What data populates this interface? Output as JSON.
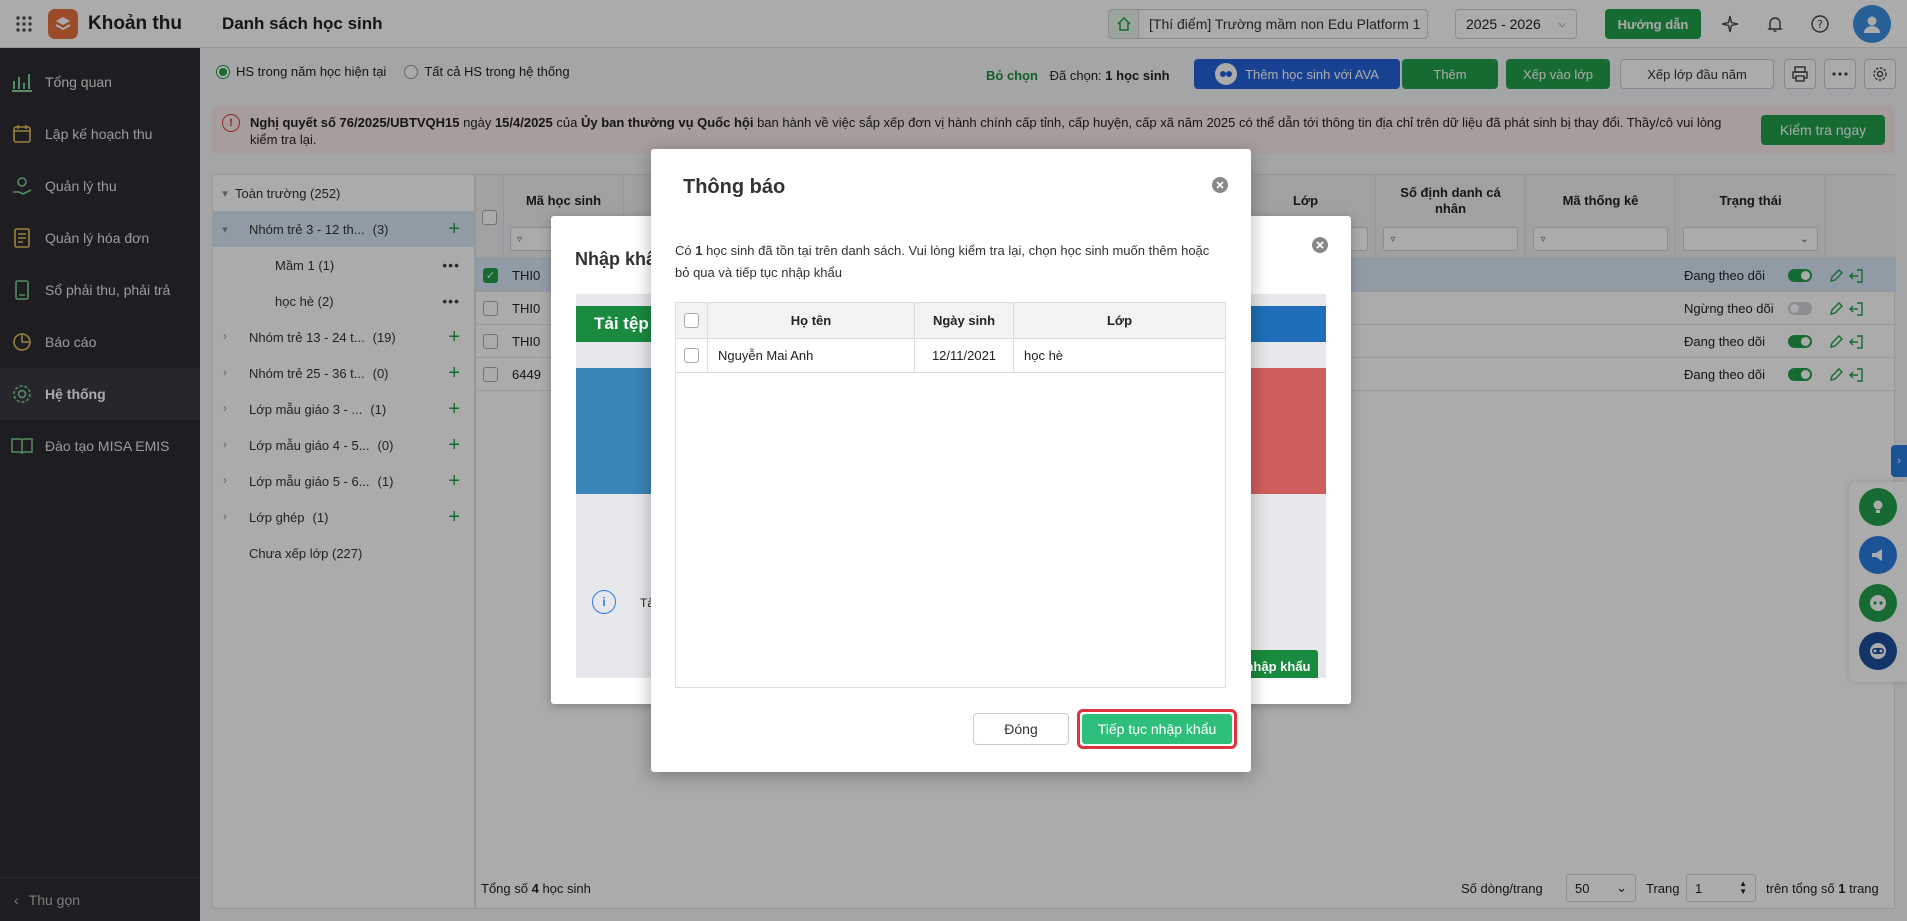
{
  "header": {
    "app_name": "Khoản thu",
    "page_title": "Danh sách học sinh",
    "school": "[Thí điểm] Trường mầm non Edu Platform 1",
    "school_year": "2025 - 2026",
    "guide_label": "Hướng dẫn"
  },
  "sidebar": {
    "items": [
      {
        "label": "Tổng quan",
        "icon": "chart-icon"
      },
      {
        "label": "Lập kế hoạch thu",
        "icon": "calendar-money-icon"
      },
      {
        "label": "Quản lý thu",
        "icon": "money-hand-icon"
      },
      {
        "label": "Quản lý hóa đơn",
        "icon": "invoice-icon"
      },
      {
        "label": "Sổ phải thu, phải trả",
        "icon": "ledger-icon"
      },
      {
        "label": "Báo cáo",
        "icon": "pie-chart-icon"
      },
      {
        "label": "Hệ thống",
        "icon": "gear-icon"
      },
      {
        "label": "Đào tạo MISA EMIS",
        "icon": "book-icon"
      }
    ],
    "collapse_label": "Thu gọn"
  },
  "filters": {
    "radio_current": "HS trong năm học hiện tại",
    "radio_all": "Tất cả HS trong hệ thống",
    "deselect_label": "Bỏ chọn",
    "selected_prefix": "Đã chọn:",
    "selected_value": "1 học sinh"
  },
  "toolbar": {
    "add_ava": "Thêm học sinh với AVA",
    "add": "Thêm",
    "assign_class": "Xếp vào lớp",
    "assign_start": "Xếp lớp đầu năm"
  },
  "notice": {
    "bold_1": "Nghị quyết số 76/2025/UBTVQH15",
    "text_1": " ngày ",
    "bold_2": "15/4/2025",
    "text_2": " của ",
    "bold_3": "Ủy ban thường vụ Quốc hội",
    "text_3": " ban hành về việc sắp xếp đơn vị hành chính cấp tỉnh, cấp huyện, cấp xã năm 2025 có thể dẫn tới thông tin địa chỉ trên dữ liệu đã phát sinh bị thay đổi. Thầy/cô vui lòng kiểm tra lại.",
    "button": "Kiểm tra ngay"
  },
  "tree": [
    {
      "label": "Toàn trường (252)",
      "level": 0,
      "arrow": "▾",
      "action": ""
    },
    {
      "label": "Nhóm trẻ 3 - 12 th...",
      "count": "(3)",
      "level": 1,
      "arrow": "▾",
      "action": "+",
      "selected": true
    },
    {
      "label": "Mầm 1 (1)",
      "level": 2,
      "arrow": "",
      "action": "•••"
    },
    {
      "label": "học hè  (2)",
      "level": 2,
      "arrow": "",
      "action": "•••"
    },
    {
      "label": "Nhóm trẻ 13 - 24 t...",
      "count": "(19)",
      "level": 1,
      "arrow": "›",
      "action": "+"
    },
    {
      "label": "Nhóm trẻ 25 - 36 t...",
      "count": "(0)",
      "level": 1,
      "arrow": "›",
      "action": "+"
    },
    {
      "label": "Lớp mẫu giáo 3 - ...",
      "count": "(1)",
      "level": 1,
      "arrow": "›",
      "action": "+"
    },
    {
      "label": "Lớp mẫu giáo 4 - 5...",
      "count": "(0)",
      "level": 1,
      "arrow": "›",
      "action": "+"
    },
    {
      "label": "Lớp mẫu giáo 5 - 6...",
      "count": "(1)",
      "level": 1,
      "arrow": "›",
      "action": "+"
    },
    {
      "label": "Lớp ghép",
      "count": "(1)",
      "level": 1,
      "arrow": "›",
      "action": "+"
    },
    {
      "label": "Chưa xếp lớp  (227)",
      "level": 1,
      "arrow": "",
      "action": ""
    }
  ],
  "table": {
    "columns": [
      "Mã học sinh",
      "Lớp",
      "Số định danh cá nhân",
      "Mã thống kê",
      "Trạng thái"
    ],
    "rows": [
      {
        "code": "THI0",
        "status": "Đang theo dõi",
        "on": true,
        "checked": true
      },
      {
        "code": "THI0",
        "status": "Ngừng theo dõi",
        "on": false,
        "checked": false
      },
      {
        "code": "THI0",
        "status": "Đang theo dõi",
        "on": true,
        "checked": false
      },
      {
        "code": "6449",
        "status": "Đang theo dõi",
        "on": true,
        "checked": false
      }
    ],
    "footer_total_prefix": "Tổng số ",
    "footer_total_value": "4",
    "footer_total_suffix": " học sinh",
    "rows_per_page_label": "Số dòng/trang",
    "rows_per_page": "50",
    "page_label": "Trang",
    "page": "1",
    "total_pages_prefix": "trên tổng số ",
    "total_pages": "1",
    "total_pages_suffix": " trang"
  },
  "import_dialog": {
    "title": "Nhập khẩu",
    "banner": "Tải tệp",
    "info_text": "Tả",
    "import_btn": "nhập khẩu"
  },
  "notify_dialog": {
    "title": "Thông báo",
    "message_1": "Có ",
    "message_count": "1",
    "message_2": " học sinh đã tồn tại trên danh sách. Vui lòng kiểm tra lại, chọn học sinh muốn thêm hoặc bỏ qua và tiếp tục nhập khẩu",
    "columns": [
      "Họ tên",
      "Ngày sinh",
      "Lớp"
    ],
    "rows": [
      {
        "name": "Nguyễn Mai Anh",
        "dob": "12/11/2021",
        "class": "học hè"
      }
    ],
    "close_label": "Đóng",
    "continue_label": "Tiếp tục nhập khẩu"
  },
  "colors": {
    "primary_green": "#22a04b",
    "highlight_red": "#e0313c",
    "sidebar_bg": "#2d2d33"
  }
}
